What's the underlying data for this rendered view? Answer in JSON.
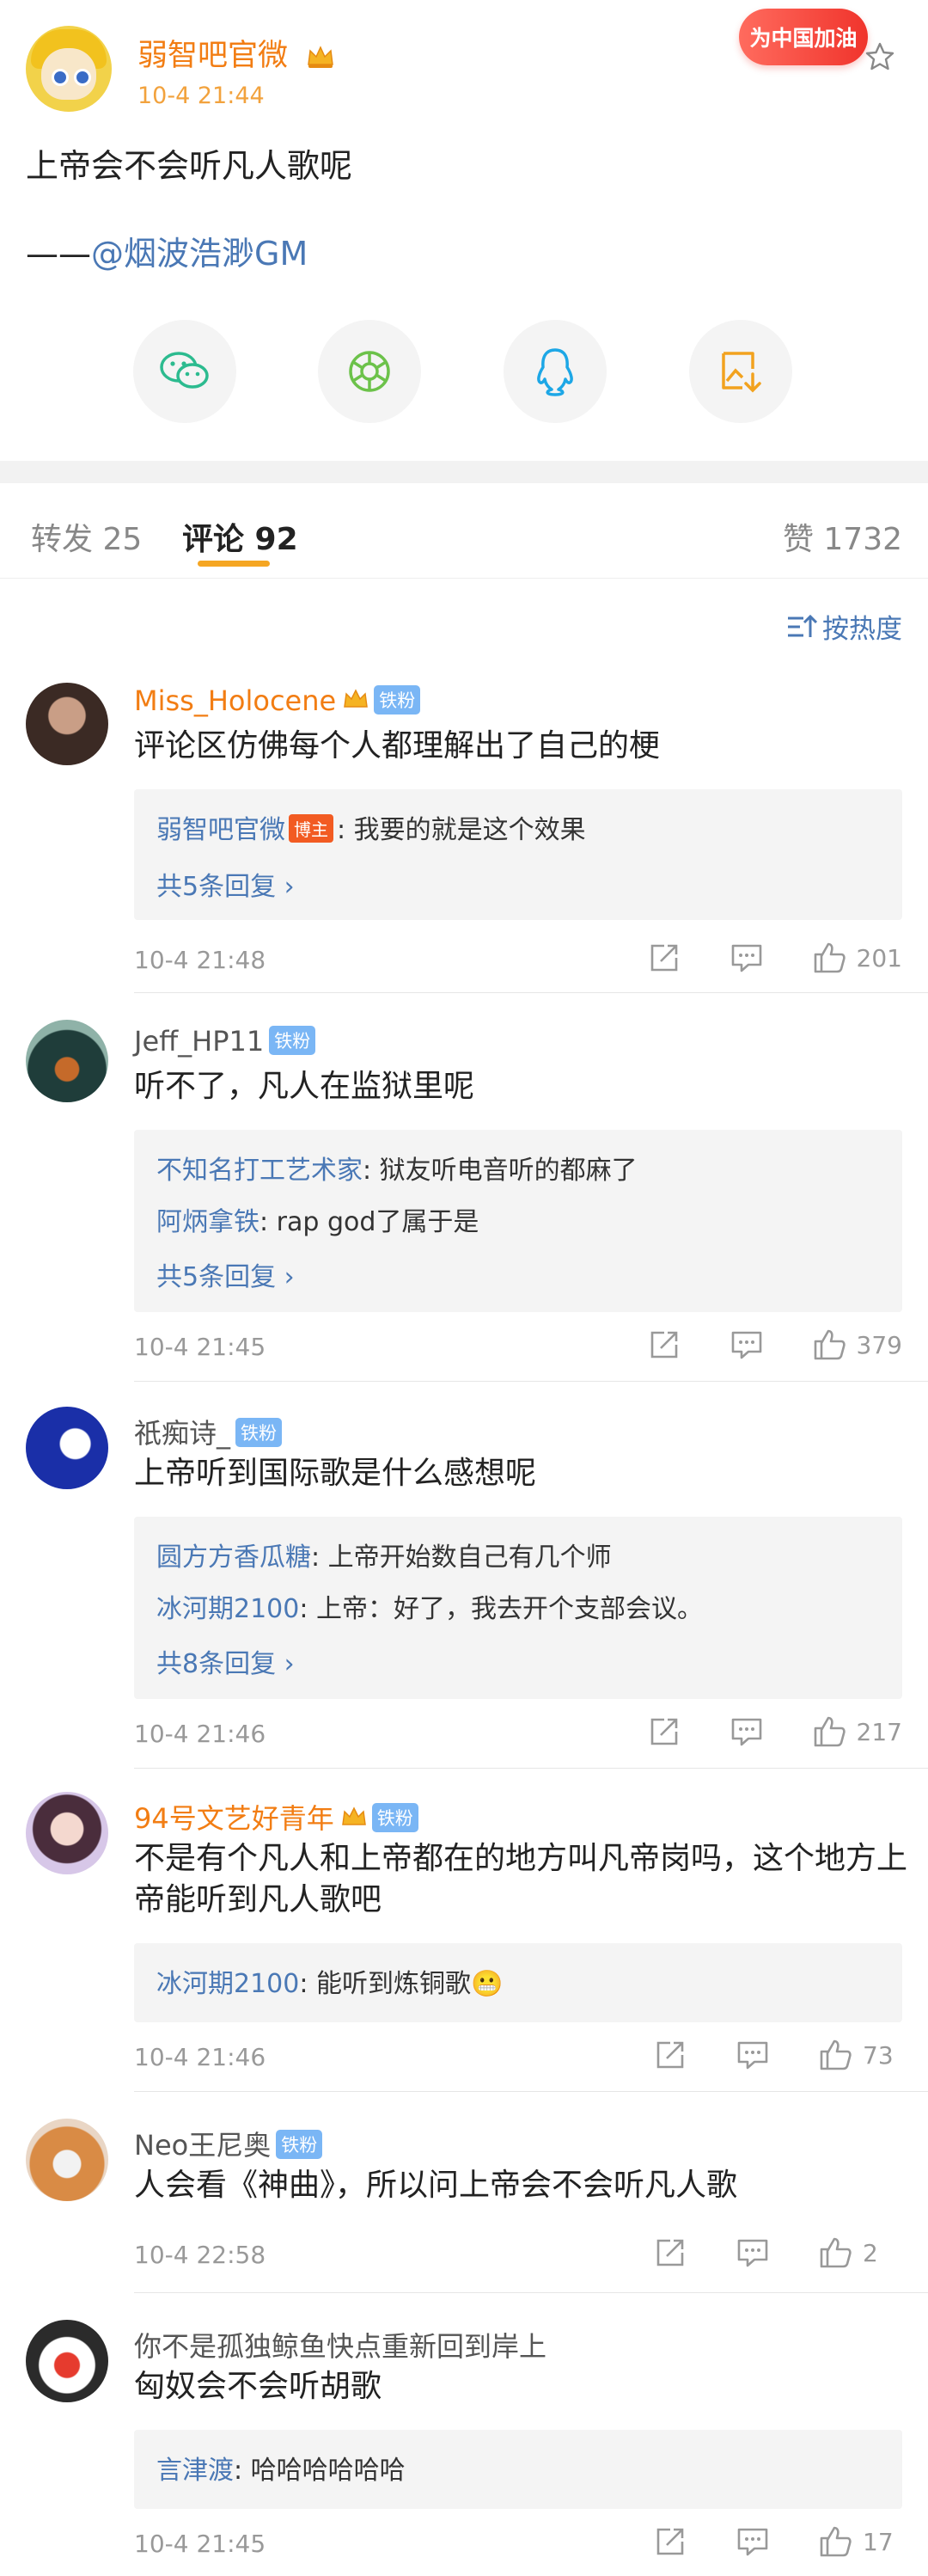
{
  "post": {
    "author": "弱智吧官微",
    "time": "10-4 21:44",
    "badge": "为中国加油",
    "text": "上帝会不会听凡人歌呢",
    "byline_prefix": "——",
    "byline_link": "@烟波浩渺GM",
    "share_icons": [
      "wechat-icon",
      "moments-icon",
      "qq-icon",
      "save-image-icon"
    ]
  },
  "tabs": {
    "repost": "转发 25",
    "comments": "评论 92",
    "likes": "赞 1732"
  },
  "sort_label": "按热度",
  "comments": [
    {
      "name": "Miss_Holocene",
      "fan": "铁粉",
      "text": "评论区仿佛每个人都理解出了自己的梗",
      "replies": [
        {
          "who": "弱智吧官微",
          "host": "博主",
          "text": ": 我要的就是这个效果"
        }
      ],
      "more": "共5条回复 ›",
      "time": "10-4 21:48",
      "likes": "201"
    },
    {
      "name": "Jeff_HP11",
      "fan": "铁粉",
      "text": "听不了，凡人在监狱里呢",
      "replies": [
        {
          "who": "不知名打工艺术家",
          "text": ": 狱友听电音听的都麻了"
        },
        {
          "who": "阿炳拿铁",
          "text": ": rap god了属于是"
        }
      ],
      "more": "共5条回复 ›",
      "time": "10-4 21:45",
      "likes": "379"
    },
    {
      "name": "祇痴诗_",
      "fan": "铁粉",
      "text": "上帝听到国际歌是什么感想呢",
      "replies": [
        {
          "who": "圆方方香瓜糖",
          "text": ": 上帝开始数自己有几个师"
        },
        {
          "who": "冰河期2100",
          "text": ": 上帝：好了，我去开个支部会议。"
        }
      ],
      "more": "共8条回复 ›",
      "time": "10-4 21:46",
      "likes": "217"
    },
    {
      "name": "94号文艺好青年",
      "fan": "铁粉",
      "text": "不是有个凡人和上帝都在的地方叫凡帝岗吗，这个地方上帝能听到凡人歌吧",
      "replies": [
        {
          "who": "冰河期2100",
          "text": ": 能听到炼铜歌😬"
        }
      ],
      "time": "10-4 21:46",
      "likes": "73"
    },
    {
      "name": "Neo王尼奥",
      "fan": "铁粉",
      "text": "人会看《神曲》，所以问上帝会不会听凡人歌",
      "time": "10-4 22:58",
      "likes": "2"
    },
    {
      "name": "你不是孤独鲸鱼快点重新回到岸上",
      "text": "匈奴会不会听胡歌",
      "replies": [
        {
          "who": "言津渡",
          "text": ": 哈哈哈哈哈哈"
        }
      ],
      "time": "10-4 21:45",
      "likes": "17"
    }
  ],
  "colors": {
    "accent": "#f27d13",
    "link": "#4a78b5",
    "tab_underline": "#f5a623"
  }
}
